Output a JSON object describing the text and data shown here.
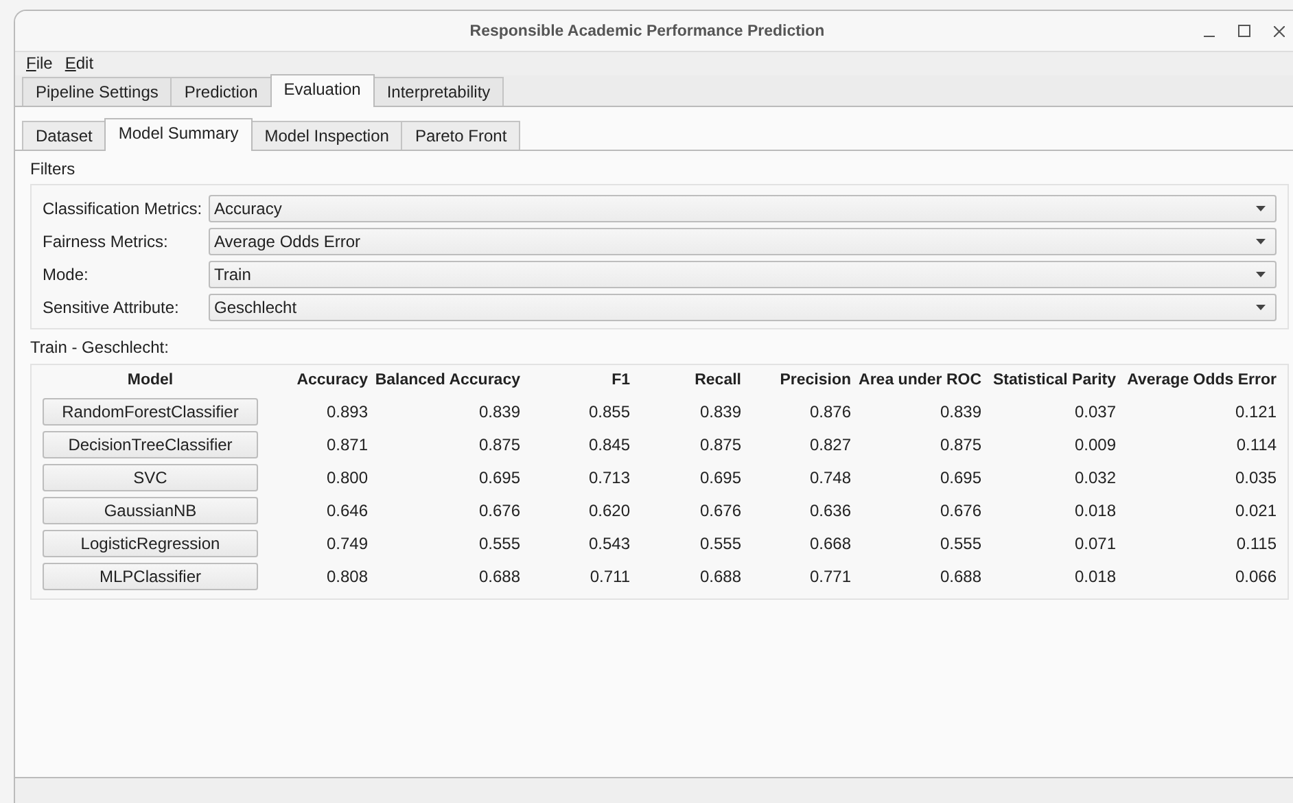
{
  "window": {
    "title": "Responsible Academic Performance Prediction"
  },
  "menu": [
    "File",
    "Edit"
  ],
  "tabs": [
    {
      "label": "Pipeline Settings",
      "selected": false
    },
    {
      "label": "Prediction",
      "selected": false
    },
    {
      "label": "Evaluation",
      "selected": true
    },
    {
      "label": "Interpretability",
      "selected": false
    }
  ],
  "subtabs": [
    {
      "label": "Dataset",
      "selected": false
    },
    {
      "label": "Model Summary",
      "selected": true
    },
    {
      "label": "Model Inspection",
      "selected": false
    },
    {
      "label": "Pareto Front",
      "selected": false
    }
  ],
  "filters": {
    "title": "Filters",
    "fields": [
      {
        "label": "Classification Metrics:",
        "value": "Accuracy"
      },
      {
        "label": "Fairness Metrics:",
        "value": "Average Odds Error"
      },
      {
        "label": "Mode:",
        "value": "Train"
      },
      {
        "label": "Sensitive Attribute:",
        "value": "Geschlecht"
      }
    ]
  },
  "table": {
    "title": "Train - Geschlecht:",
    "columns": [
      "Model",
      "Accuracy",
      "Balanced Accuracy",
      "F1",
      "Recall",
      "Precision",
      "Area under ROC",
      "Statistical Parity",
      "Average Odds Error"
    ],
    "rows": [
      [
        "RandomForestClassifier",
        "0.893",
        "0.839",
        "0.855",
        "0.839",
        "0.876",
        "0.839",
        "0.037",
        "0.121"
      ],
      [
        "DecisionTreeClassifier",
        "0.871",
        "0.875",
        "0.845",
        "0.875",
        "0.827",
        "0.875",
        "0.009",
        "0.114"
      ],
      [
        "SVC",
        "0.800",
        "0.695",
        "0.713",
        "0.695",
        "0.748",
        "0.695",
        "0.032",
        "0.035"
      ],
      [
        "GaussianNB",
        "0.646",
        "0.676",
        "0.620",
        "0.676",
        "0.636",
        "0.676",
        "0.018",
        "0.021"
      ],
      [
        "LogisticRegression",
        "0.749",
        "0.555",
        "0.543",
        "0.555",
        "0.668",
        "0.555",
        "0.071",
        "0.115"
      ],
      [
        "MLPClassifier",
        "0.808",
        "0.688",
        "0.711",
        "0.688",
        "0.771",
        "0.688",
        "0.018",
        "0.066"
      ]
    ]
  }
}
